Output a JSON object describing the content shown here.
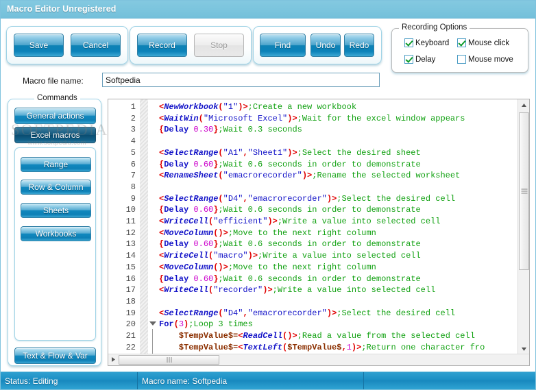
{
  "window": {
    "title": "Macro Editor Unregistered"
  },
  "toolbar": {
    "groups": [
      {
        "name": "file-group",
        "buttons": [
          {
            "id": "save",
            "label": "Save",
            "disabled": false
          },
          {
            "id": "cancel",
            "label": "Cancel",
            "disabled": false
          }
        ]
      },
      {
        "name": "record-group",
        "buttons": [
          {
            "id": "record",
            "label": "Record",
            "disabled": false
          },
          {
            "id": "stop",
            "label": "Stop",
            "disabled": true
          }
        ]
      },
      {
        "name": "edit-group",
        "buttons": [
          {
            "id": "find",
            "label": "Find",
            "disabled": false
          },
          {
            "id": "undo",
            "label": "Undo",
            "disabled": false
          },
          {
            "id": "redo",
            "label": "Redo",
            "disabled": false
          }
        ]
      }
    ]
  },
  "recording_options": {
    "legend": "Recording Options",
    "items": [
      {
        "id": "keyboard",
        "label": "Keyboard",
        "checked": true
      },
      {
        "id": "mouse-click",
        "label": "Mouse click",
        "checked": true
      },
      {
        "id": "delay",
        "label": "Delay",
        "checked": true
      },
      {
        "id": "mouse-move",
        "label": "Mouse move",
        "checked": false
      }
    ]
  },
  "macro_file": {
    "label": "Macro file name:",
    "value": "Softpedia",
    "placeholder": ""
  },
  "commands": {
    "legend": "Commands",
    "top_buttons": [
      {
        "id": "general-actions",
        "label": "General actions",
        "selected": false
      },
      {
        "id": "excel-macros",
        "label": "Excel macros",
        "selected": true
      }
    ],
    "sub_buttons": [
      {
        "id": "range",
        "label": "Range"
      },
      {
        "id": "row-column",
        "label": "Row & Column"
      },
      {
        "id": "sheets",
        "label": "Sheets"
      },
      {
        "id": "workbooks",
        "label": "Workbooks"
      }
    ],
    "bottom_button": {
      "id": "text-flow-var",
      "label": "Text & Flow & Var"
    }
  },
  "watermark": {
    "main": "SOFTPEDIA",
    "sub": "www.softpedia.com"
  },
  "editor": {
    "lines": [
      {
        "n": "1",
        "indent": 0,
        "fold": "",
        "tokens": [
          {
            "c": "t-ang",
            "t": "<"
          },
          {
            "c": "t-fn",
            "t": "NewWorkbook"
          },
          {
            "c": "t-paren",
            "t": "("
          },
          {
            "c": "t-str",
            "t": "\"1\""
          },
          {
            "c": "t-paren",
            "t": ")"
          },
          {
            "c": "t-ang",
            "t": ">"
          },
          {
            "c": "t-cmt",
            "t": ";Create a new workbook"
          }
        ]
      },
      {
        "n": "2",
        "indent": 0,
        "fold": "",
        "tokens": [
          {
            "c": "t-ang",
            "t": "<"
          },
          {
            "c": "t-fn",
            "t": "WaitWin"
          },
          {
            "c": "t-paren",
            "t": "("
          },
          {
            "c": "t-str",
            "t": "\"Microsoft Excel\""
          },
          {
            "c": "t-paren",
            "t": ")"
          },
          {
            "c": "t-ang",
            "t": ">"
          },
          {
            "c": "t-cmt",
            "t": ";Wait for the excel window appears"
          }
        ]
      },
      {
        "n": "3",
        "indent": 0,
        "fold": "",
        "tokens": [
          {
            "c": "t-brace",
            "t": "{"
          },
          {
            "c": "t-kw",
            "t": "Delay"
          },
          {
            "c": "t-plain",
            "t": " "
          },
          {
            "c": "t-num",
            "t": "0.30"
          },
          {
            "c": "t-brace",
            "t": "}"
          },
          {
            "c": "t-cmt",
            "t": ";Wait 0.3 seconds"
          }
        ]
      },
      {
        "n": "4",
        "indent": 0,
        "fold": "",
        "tokens": []
      },
      {
        "n": "5",
        "indent": 0,
        "fold": "",
        "tokens": [
          {
            "c": "t-ang",
            "t": "<"
          },
          {
            "c": "t-fn",
            "t": "SelectRange"
          },
          {
            "c": "t-paren",
            "t": "("
          },
          {
            "c": "t-str",
            "t": "\"A1\""
          },
          {
            "c": "t-paren",
            "t": ","
          },
          {
            "c": "t-str",
            "t": "\"Sheet1\""
          },
          {
            "c": "t-paren",
            "t": ")"
          },
          {
            "c": "t-ang",
            "t": ">"
          },
          {
            "c": "t-cmt",
            "t": ";Select the desired sheet"
          }
        ]
      },
      {
        "n": "6",
        "indent": 0,
        "fold": "",
        "tokens": [
          {
            "c": "t-brace",
            "t": "{"
          },
          {
            "c": "t-kw",
            "t": "Delay"
          },
          {
            "c": "t-plain",
            "t": " "
          },
          {
            "c": "t-num",
            "t": "0.60"
          },
          {
            "c": "t-brace",
            "t": "}"
          },
          {
            "c": "t-cmt",
            "t": ";Wait 0.6 seconds in order to demonstrate"
          }
        ]
      },
      {
        "n": "7",
        "indent": 0,
        "fold": "",
        "tokens": [
          {
            "c": "t-ang",
            "t": "<"
          },
          {
            "c": "t-fn",
            "t": "RenameSheet"
          },
          {
            "c": "t-paren",
            "t": "("
          },
          {
            "c": "t-str",
            "t": "\"emacrorecorder\""
          },
          {
            "c": "t-paren",
            "t": ")"
          },
          {
            "c": "t-ang",
            "t": ">"
          },
          {
            "c": "t-cmt",
            "t": ";Rename the selected worksheet"
          }
        ]
      },
      {
        "n": "8",
        "indent": 0,
        "fold": "",
        "tokens": []
      },
      {
        "n": "9",
        "indent": 0,
        "fold": "",
        "tokens": [
          {
            "c": "t-ang",
            "t": "<"
          },
          {
            "c": "t-fn",
            "t": "SelectRange"
          },
          {
            "c": "t-paren",
            "t": "("
          },
          {
            "c": "t-str",
            "t": "\"D4\""
          },
          {
            "c": "t-paren",
            "t": ","
          },
          {
            "c": "t-str",
            "t": "\"emacrorecorder\""
          },
          {
            "c": "t-paren",
            "t": ")"
          },
          {
            "c": "t-ang",
            "t": ">"
          },
          {
            "c": "t-cmt",
            "t": ";Select the desired cell"
          }
        ]
      },
      {
        "n": "10",
        "indent": 0,
        "fold": "",
        "tokens": [
          {
            "c": "t-brace",
            "t": "{"
          },
          {
            "c": "t-kw",
            "t": "Delay"
          },
          {
            "c": "t-plain",
            "t": " "
          },
          {
            "c": "t-num",
            "t": "0.60"
          },
          {
            "c": "t-brace",
            "t": "}"
          },
          {
            "c": "t-cmt",
            "t": ";Wait 0.6 seconds in order to demonstrate"
          }
        ]
      },
      {
        "n": "11",
        "indent": 0,
        "fold": "",
        "tokens": [
          {
            "c": "t-ang",
            "t": "<"
          },
          {
            "c": "t-fn",
            "t": "WriteCell"
          },
          {
            "c": "t-paren",
            "t": "("
          },
          {
            "c": "t-str",
            "t": "\"efficient\""
          },
          {
            "c": "t-paren",
            "t": ")"
          },
          {
            "c": "t-ang",
            "t": ">"
          },
          {
            "c": "t-cmt",
            "t": ";Write a value into selected cell"
          }
        ]
      },
      {
        "n": "12",
        "indent": 0,
        "fold": "",
        "tokens": [
          {
            "c": "t-ang",
            "t": "<"
          },
          {
            "c": "t-fn",
            "t": "MoveColumn"
          },
          {
            "c": "t-paren",
            "t": "()"
          },
          {
            "c": "t-ang",
            "t": ">"
          },
          {
            "c": "t-cmt",
            "t": ";Move to the next right column"
          }
        ]
      },
      {
        "n": "13",
        "indent": 0,
        "fold": "",
        "tokens": [
          {
            "c": "t-brace",
            "t": "{"
          },
          {
            "c": "t-kw",
            "t": "Delay"
          },
          {
            "c": "t-plain",
            "t": " "
          },
          {
            "c": "t-num",
            "t": "0.60"
          },
          {
            "c": "t-brace",
            "t": "}"
          },
          {
            "c": "t-cmt",
            "t": ";Wait 0.6 seconds in order to demonstrate"
          }
        ]
      },
      {
        "n": "14",
        "indent": 0,
        "fold": "",
        "tokens": [
          {
            "c": "t-ang",
            "t": "<"
          },
          {
            "c": "t-fn",
            "t": "WriteCell"
          },
          {
            "c": "t-paren",
            "t": "("
          },
          {
            "c": "t-str",
            "t": "\"macro\""
          },
          {
            "c": "t-paren",
            "t": ")"
          },
          {
            "c": "t-ang",
            "t": ">"
          },
          {
            "c": "t-cmt",
            "t": ";Write a value into selected cell"
          }
        ]
      },
      {
        "n": "15",
        "indent": 0,
        "fold": "",
        "tokens": [
          {
            "c": "t-ang",
            "t": "<"
          },
          {
            "c": "t-fn",
            "t": "MoveColumn"
          },
          {
            "c": "t-paren",
            "t": "()"
          },
          {
            "c": "t-ang",
            "t": ">"
          },
          {
            "c": "t-cmt",
            "t": ";Move to the next right column"
          }
        ]
      },
      {
        "n": "16",
        "indent": 0,
        "fold": "",
        "tokens": [
          {
            "c": "t-brace",
            "t": "{"
          },
          {
            "c": "t-kw",
            "t": "Delay"
          },
          {
            "c": "t-plain",
            "t": " "
          },
          {
            "c": "t-num",
            "t": "0.60"
          },
          {
            "c": "t-brace",
            "t": "}"
          },
          {
            "c": "t-cmt",
            "t": ";Wait 0.6 seconds in order to demonstrate"
          }
        ]
      },
      {
        "n": "17",
        "indent": 0,
        "fold": "",
        "tokens": [
          {
            "c": "t-ang",
            "t": "<"
          },
          {
            "c": "t-fn",
            "t": "WriteCell"
          },
          {
            "c": "t-paren",
            "t": "("
          },
          {
            "c": "t-str",
            "t": "\"recorder\""
          },
          {
            "c": "t-paren",
            "t": ")"
          },
          {
            "c": "t-ang",
            "t": ">"
          },
          {
            "c": "t-cmt",
            "t": ";Write a value into selected cell"
          }
        ]
      },
      {
        "n": "18",
        "indent": 0,
        "fold": "",
        "tokens": []
      },
      {
        "n": "19",
        "indent": 0,
        "fold": "",
        "tokens": [
          {
            "c": "t-ang",
            "t": "<"
          },
          {
            "c": "t-fn",
            "t": "SelectRange"
          },
          {
            "c": "t-paren",
            "t": "("
          },
          {
            "c": "t-str",
            "t": "\"D4\""
          },
          {
            "c": "t-paren",
            "t": ","
          },
          {
            "c": "t-str",
            "t": "\"emacrorecorder\""
          },
          {
            "c": "t-paren",
            "t": ")"
          },
          {
            "c": "t-ang",
            "t": ">"
          },
          {
            "c": "t-cmt",
            "t": ";Select the desired cell"
          }
        ]
      },
      {
        "n": "20",
        "indent": 0,
        "fold": "open",
        "tokens": [
          {
            "c": "t-kw",
            "t": "For"
          },
          {
            "c": "t-paren",
            "t": "("
          },
          {
            "c": "t-num",
            "t": "3"
          },
          {
            "c": "t-paren",
            "t": ")"
          },
          {
            "c": "t-cmt",
            "t": ";Loop 3 times"
          }
        ]
      },
      {
        "n": "21",
        "indent": 1,
        "fold": "",
        "tokens": [
          {
            "c": "t-var",
            "t": "$TempValue$"
          },
          {
            "c": "t-var",
            "t": "="
          },
          {
            "c": "t-ang",
            "t": "<"
          },
          {
            "c": "t-fn",
            "t": "ReadCell"
          },
          {
            "c": "t-paren",
            "t": "()"
          },
          {
            "c": "t-ang",
            "t": ">"
          },
          {
            "c": "t-cmt",
            "t": ";Read a value from the selected cell"
          }
        ]
      },
      {
        "n": "22",
        "indent": 1,
        "fold": "",
        "tokens": [
          {
            "c": "t-var",
            "t": "$TempValue$"
          },
          {
            "c": "t-var",
            "t": "="
          },
          {
            "c": "t-ang",
            "t": "<"
          },
          {
            "c": "t-fn",
            "t": "TextLeft"
          },
          {
            "c": "t-paren",
            "t": "("
          },
          {
            "c": "t-var",
            "t": "$TempValue$"
          },
          {
            "c": "t-paren",
            "t": ","
          },
          {
            "c": "t-num",
            "t": "1"
          },
          {
            "c": "t-paren",
            "t": ")"
          },
          {
            "c": "t-ang",
            "t": ">"
          },
          {
            "c": "t-cmt",
            "t": ";Return one character fro"
          }
        ]
      }
    ]
  },
  "statusbar": {
    "cells": [
      {
        "id": "status",
        "text": "Status: Editing"
      },
      {
        "id": "macro-name",
        "text": "Macro name: Softpedia"
      },
      {
        "id": "extra",
        "text": ""
      }
    ]
  }
}
